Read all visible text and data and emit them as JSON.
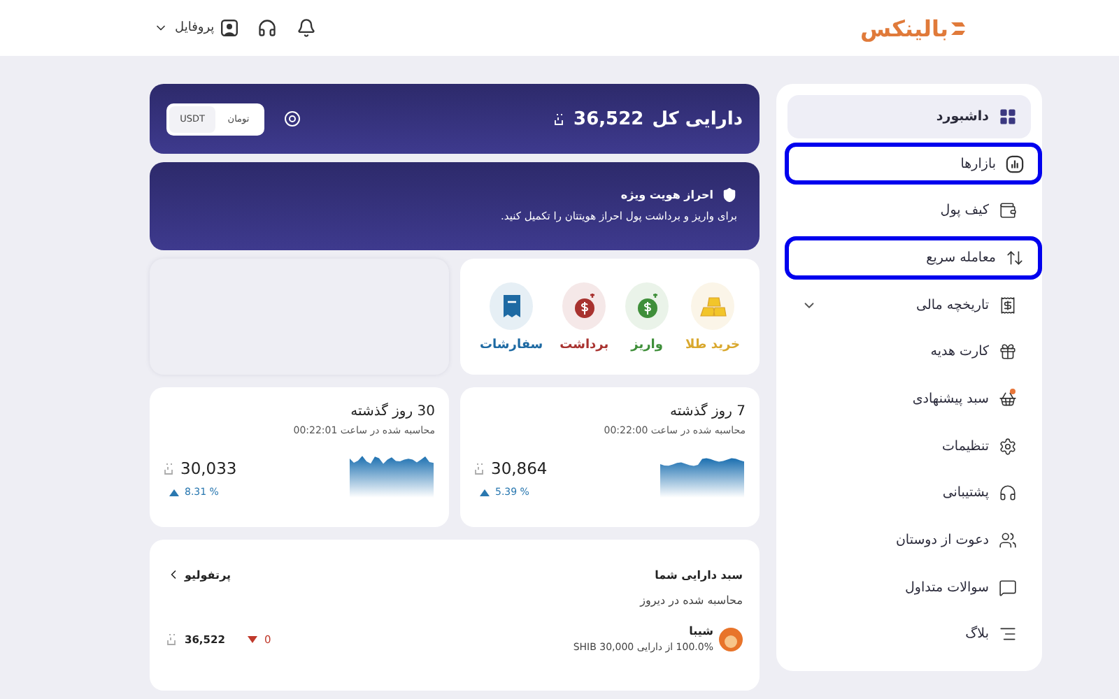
{
  "header": {
    "logo": "بالینکس",
    "profile": "پروفایل"
  },
  "sidebar": {
    "items": [
      {
        "label": "داشبورد",
        "kind": "dashboard",
        "selected": true,
        "highlighted": false
      },
      {
        "label": "بازارها",
        "kind": "markets",
        "selected": false,
        "highlighted": true
      },
      {
        "label": "کیف پول",
        "kind": "wallet",
        "selected": false,
        "highlighted": false
      },
      {
        "label": "معامله سریع",
        "kind": "trade",
        "selected": false,
        "highlighted": true
      },
      {
        "label": "تاریخچه مالی",
        "kind": "history",
        "selected": false,
        "highlighted": false,
        "expanded": false
      },
      {
        "label": "کارت هدیه",
        "kind": "gift",
        "selected": false,
        "highlighted": false
      },
      {
        "label": "سبد پیشنهادی",
        "kind": "basket",
        "selected": false,
        "highlighted": false,
        "notify": true
      },
      {
        "label": "تنظیمات",
        "kind": "settings",
        "selected": false,
        "highlighted": false
      },
      {
        "label": "پشتیبانی",
        "kind": "support",
        "selected": false,
        "highlighted": false
      },
      {
        "label": "دعوت از دوستان",
        "kind": "invite",
        "selected": false,
        "highlighted": false
      },
      {
        "label": "سوالات متداول",
        "kind": "faq",
        "selected": false,
        "highlighted": false
      },
      {
        "label": "بلاگ",
        "kind": "blog",
        "selected": false,
        "highlighted": false
      }
    ]
  },
  "balance": {
    "title": "دارایی کل",
    "amount": "36,522",
    "currencies": [
      {
        "label": "تومان",
        "selected": true
      },
      {
        "label": "USDT",
        "selected": false
      }
    ]
  },
  "kyc": {
    "title": "احراز هویت ویژه",
    "text": "برای واریز و برداشت پول احراز هویتتان را تکمیل کنید."
  },
  "actions": [
    {
      "label": "خرید طلا",
      "kind": "gold",
      "color": "#d9a82e"
    },
    {
      "label": "واریز",
      "kind": "deposit",
      "color": "#3f8f3a"
    },
    {
      "label": "برداشت",
      "kind": "withdraw",
      "color": "#a8322f"
    },
    {
      "label": "سفارشات",
      "kind": "orders",
      "color": "#1e6aa3"
    }
  ],
  "stats": [
    {
      "title": "7 روز گذشته",
      "subtitle": "محاسبه شده در ساعت 00:22:00",
      "value": "30,864",
      "change": "5.39 %",
      "rising": true
    },
    {
      "title": "30 روز گذشته",
      "subtitle": "محاسبه شده در ساعت 00:22:01",
      "value": "30,033",
      "change": "8.31 %",
      "rising": true
    }
  ],
  "portfolio": {
    "title": "سبد دارایی شما",
    "link": "پرتفولیو",
    "subtitle": "محاسبه شده در دیروز",
    "assets": [
      {
        "name": "شیبا",
        "detail": "100.0% از دارایی SHIB 30,000",
        "change": "0",
        "rising": false,
        "value": "36,522"
      }
    ]
  }
}
